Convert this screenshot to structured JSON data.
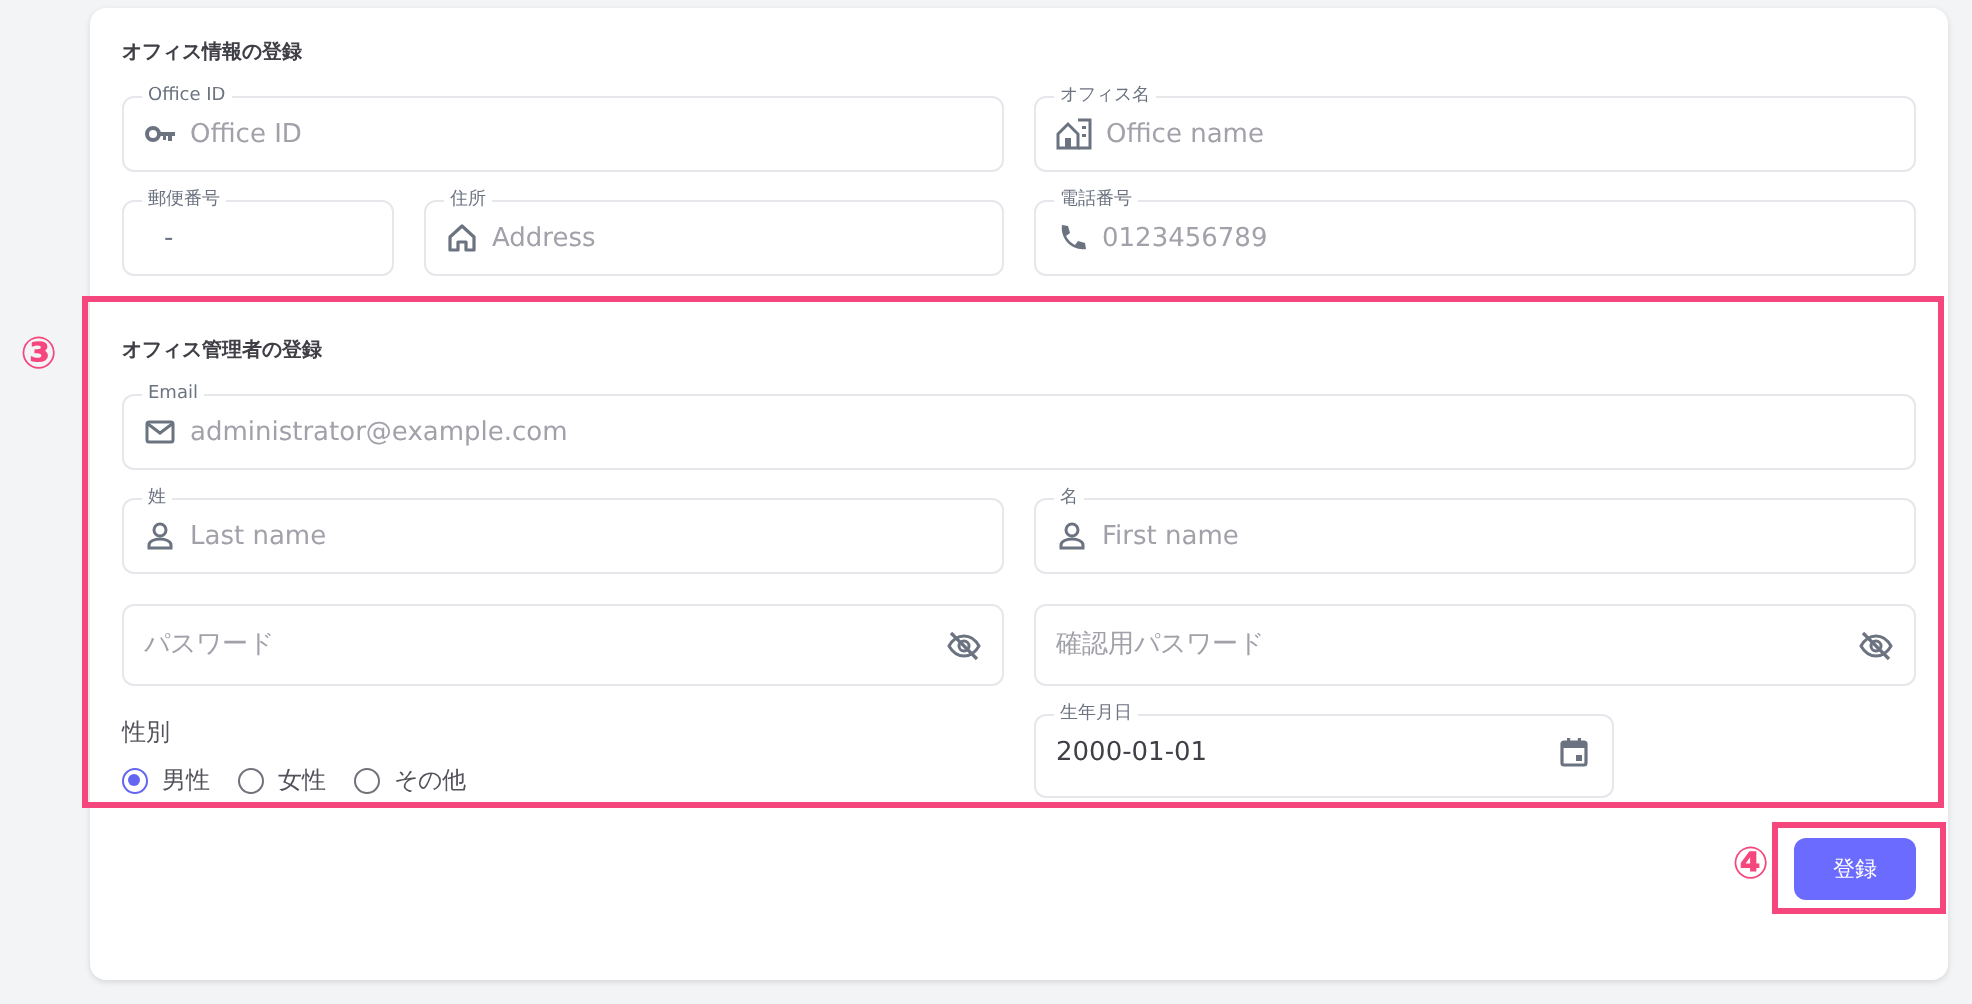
{
  "office_section": {
    "title": "オフィス情報の登録",
    "office_id": {
      "label": "Office ID",
      "placeholder": "Office ID"
    },
    "office_name": {
      "label": "オフィス名",
      "placeholder": "Office name"
    },
    "postal_code": {
      "label": "郵便番号",
      "value": "-"
    },
    "address": {
      "label": "住所",
      "placeholder": "Address"
    },
    "phone": {
      "label": "電話番号",
      "placeholder": "0123456789"
    }
  },
  "admin_section": {
    "title": "オフィス管理者の登録",
    "highlighted": true,
    "marker": "③",
    "email": {
      "label": "Email",
      "placeholder": "administrator@example.com"
    },
    "last_name": {
      "label": "姓",
      "placeholder": "Last name"
    },
    "first_name": {
      "label": "名",
      "placeholder": "First name"
    },
    "password": {
      "placeholder": "パスワード"
    },
    "password_confirm": {
      "placeholder": "確認用パスワード"
    },
    "gender": {
      "label": "性別",
      "options": [
        {
          "label": "男性",
          "selected": true
        },
        {
          "label": "女性",
          "selected": false
        },
        {
          "label": "その他",
          "selected": false
        }
      ]
    },
    "birth_date": {
      "label": "生年月日",
      "value": "2000-01-01"
    }
  },
  "submit": {
    "label": "登録",
    "highlighted": true,
    "marker": "④"
  }
}
